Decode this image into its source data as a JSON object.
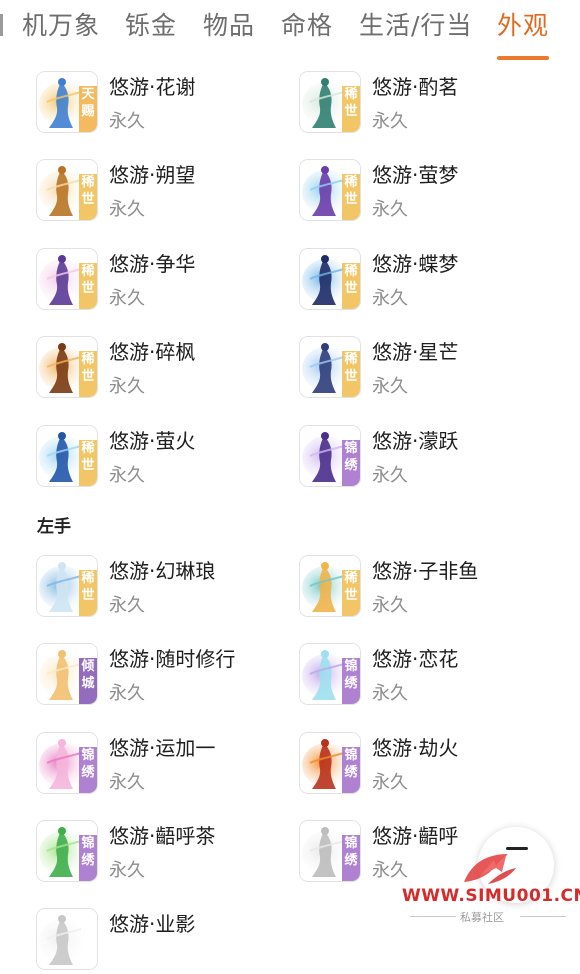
{
  "tabs": [
    {
      "label": "机万象",
      "active": false
    },
    {
      "label": "铄金",
      "active": false
    },
    {
      "label": "物品",
      "active": false
    },
    {
      "label": "命格",
      "active": false
    },
    {
      "label": "生活/行当",
      "active": false
    },
    {
      "label": "外观",
      "active": true
    }
  ],
  "colors": {
    "accent": "#e06a1e",
    "grade_tianci": "#f2b451",
    "grade_xishi": "#f1c15a",
    "grade_jinxiu": "#a777cc",
    "grade_qingcheng": "#8a5fb8"
  },
  "section_items": [
    {
      "name": "悠游·花谢",
      "duration": "永久",
      "badge": "天赐"
    },
    {
      "name": "悠游·酌茗",
      "duration": "永久",
      "badge": "稀世"
    },
    {
      "name": "悠游·朔望",
      "duration": "永久",
      "badge": "稀世"
    },
    {
      "name": "悠游·萤梦",
      "duration": "永久",
      "badge": "稀世"
    },
    {
      "name": "悠游·争华",
      "duration": "永久",
      "badge": "稀世"
    },
    {
      "name": "悠游·蝶梦",
      "duration": "永久",
      "badge": "稀世"
    },
    {
      "name": "悠游·碎枫",
      "duration": "永久",
      "badge": "稀世"
    },
    {
      "name": "悠游·星芒",
      "duration": "永久",
      "badge": "稀世"
    },
    {
      "name": "悠游·萤火",
      "duration": "永久",
      "badge": "稀世"
    },
    {
      "name": "悠游·濛跃",
      "duration": "永久",
      "badge": "锦绣"
    }
  ],
  "left_hand": {
    "label": "左手",
    "items": [
      {
        "name": "悠游·幻琳琅",
        "duration": "永久",
        "badge": "稀世"
      },
      {
        "name": "悠游·子非鱼",
        "duration": "永久",
        "badge": "稀世"
      },
      {
        "name": "悠游·随时修行",
        "duration": "永久",
        "badge": "倾城"
      },
      {
        "name": "悠游·恋花",
        "duration": "永久",
        "badge": "锦绣"
      },
      {
        "name": "悠游·运加一",
        "duration": "永久",
        "badge": "锦绣"
      },
      {
        "name": "悠游·劫火",
        "duration": "永久",
        "badge": "锦绣"
      },
      {
        "name": "悠游·齬呼茶",
        "duration": "永久",
        "badge": "锦绣"
      },
      {
        "name": "悠游·齬呼",
        "duration": "永久",
        "badge": "锦绣"
      },
      {
        "name": "悠游·业影",
        "duration": "",
        "badge": ""
      }
    ]
  },
  "watermark": {
    "text": "WWW.SIMU001.CN",
    "subtitle": "私募社区"
  },
  "icons": {
    "scroll_top": "scroll-top-icon",
    "watermark_logo": "simu-logo-icon"
  }
}
